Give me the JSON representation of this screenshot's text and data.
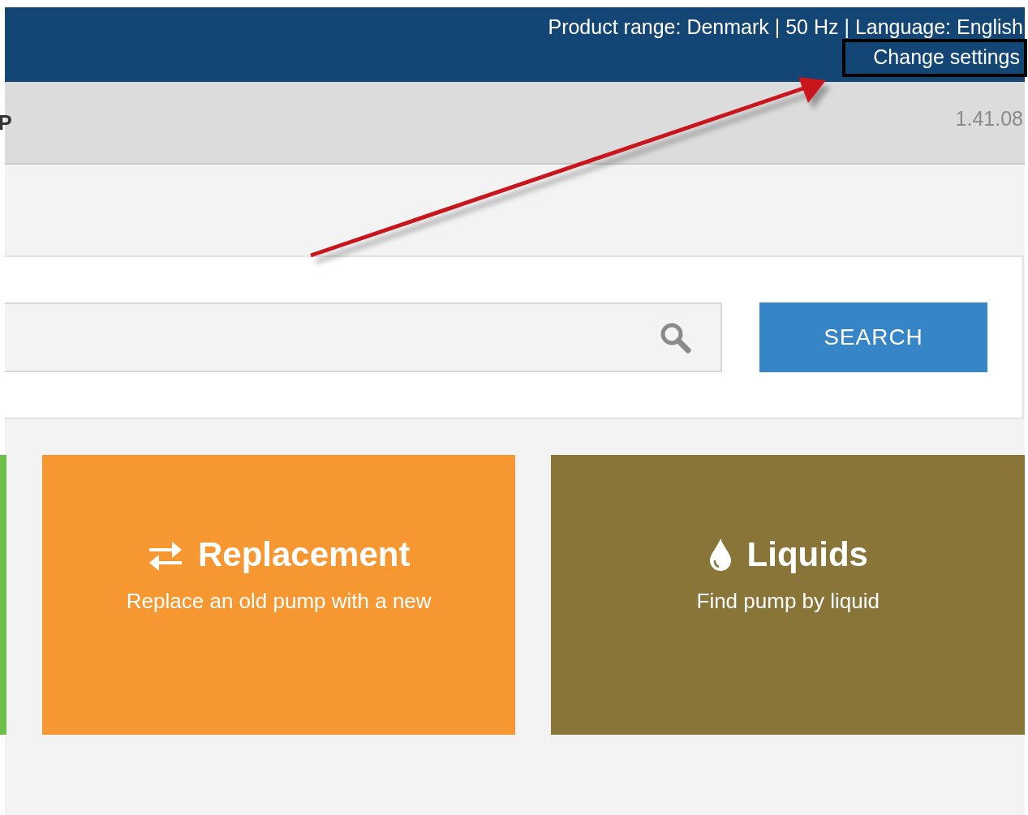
{
  "top_bar": {
    "info": "Product range: Denmark | 50 Hz | Language: English",
    "link": "Change settings"
  },
  "header": {
    "title": "P",
    "version": "1.41.08"
  },
  "search": {
    "button": "SEARCH"
  },
  "cards": [
    {
      "color": "#6cc04a"
    },
    {
      "title": "Replacement",
      "subtitle": "Replace an old pump with a new",
      "color": "#f69731"
    },
    {
      "title": "Liquids",
      "subtitle": "Find pump by liquid",
      "color": "#897538"
    }
  ]
}
